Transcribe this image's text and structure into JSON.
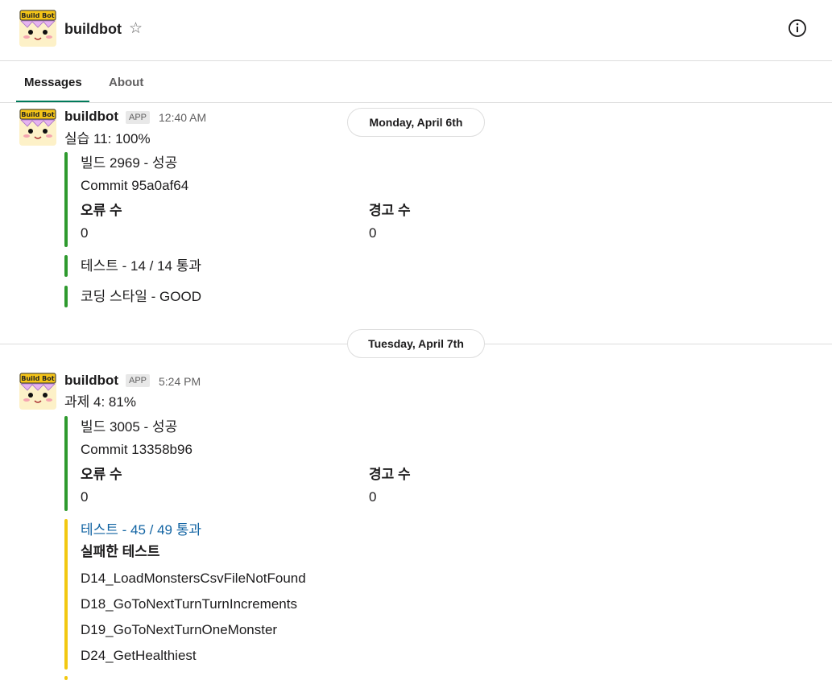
{
  "header": {
    "title": "buildbot",
    "avatar_text": "Build Bot",
    "star_icon": "star-outline-icon",
    "info_icon": "info-circle-icon"
  },
  "tabs": [
    {
      "label": "Messages",
      "active": true
    },
    {
      "label": "About",
      "active": false
    }
  ],
  "date_dividers": [
    {
      "label": "Monday, April 6th"
    },
    {
      "label": "Tuesday, April 7th"
    }
  ],
  "messages": [
    {
      "author": "buildbot",
      "badge": "APP",
      "time": "12:40 AM",
      "text": "실습 11: 100%",
      "build": {
        "title": "빌드 2969 - 성공",
        "commit": "Commit 95a0af64",
        "fields": [
          {
            "label": "오류 수",
            "value": "0"
          },
          {
            "label": "경고 수",
            "value": "0"
          }
        ],
        "color": "#2e9a2e"
      },
      "tests": {
        "title": "테스트 - 14 / 14 통과",
        "color": "#2e9a2e"
      },
      "style": {
        "title": "코딩 스타일 - GOOD",
        "color": "#2e9a2e"
      }
    },
    {
      "author": "buildbot",
      "badge": "APP",
      "time": "5:24 PM",
      "text": "과제 4: 81%",
      "build": {
        "title": "빌드 3005 - 성공",
        "commit": "Commit 13358b96",
        "fields": [
          {
            "label": "오류 수",
            "value": "0"
          },
          {
            "label": "경고 수",
            "value": "0"
          }
        ],
        "color": "#2e9a2e"
      },
      "tests": {
        "title": "테스트 - 45 / 49 통과",
        "failed_heading": "실패한 테스트",
        "failed": [
          "D14_LoadMonstersCsvFileNotFound",
          "D18_GoToNextTurnTurnIncrements",
          "D19_GoToNextTurnOneMonster",
          "D24_GetHealthiest"
        ],
        "color": "#f2c811"
      }
    }
  ]
}
